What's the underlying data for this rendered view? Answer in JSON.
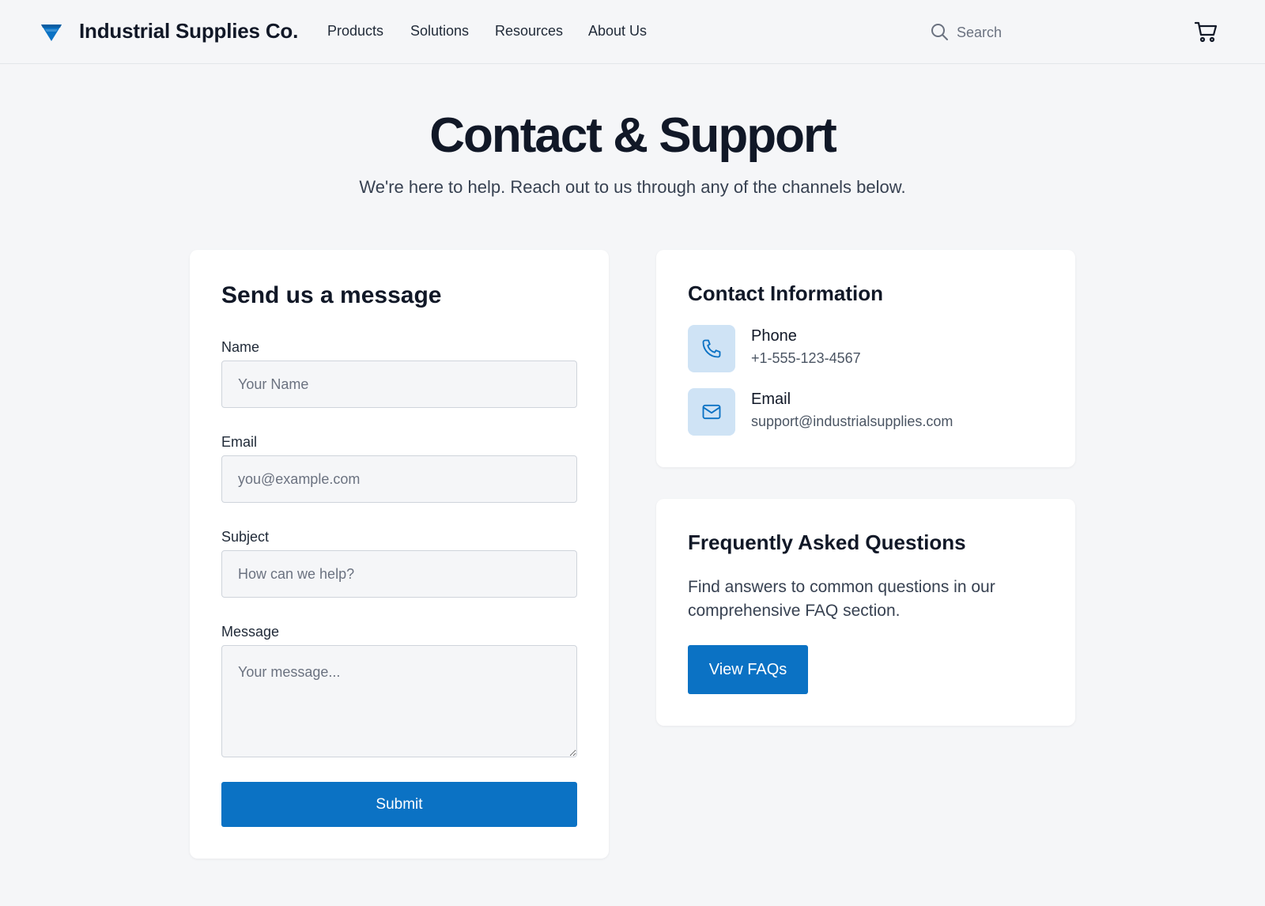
{
  "header": {
    "brand": "Industrial Supplies Co.",
    "nav": [
      "Products",
      "Solutions",
      "Resources",
      "About Us"
    ],
    "search_placeholder": "Search",
    "icons": {
      "logo": "funnel-logo-icon",
      "search": "search-icon",
      "cart": "cart-icon"
    }
  },
  "hero": {
    "title": "Contact & Support",
    "subtitle": "We're here to help. Reach out to us through any of the channels below."
  },
  "form": {
    "title": "Send us a message",
    "fields": [
      {
        "label": "Name",
        "placeholder": "Your Name",
        "value": ""
      },
      {
        "label": "Email",
        "placeholder": "you@example.com",
        "value": ""
      },
      {
        "label": "Subject",
        "placeholder": "How can we help?",
        "value": ""
      },
      {
        "label": "Message",
        "placeholder": "Your message...",
        "value": ""
      }
    ],
    "submit_label": "Submit"
  },
  "contact": {
    "title": "Contact Information",
    "items": [
      {
        "icon": "phone-icon",
        "label": "Phone",
        "value": "+1-555-123-4567"
      },
      {
        "icon": "envelope-icon",
        "label": "Email",
        "value": "support@industrialsupplies.com"
      }
    ]
  },
  "faq": {
    "title": "Frequently Asked Questions",
    "text": "Find answers to common questions in our comprehensive FAQ section.",
    "button_label": "View FAQs"
  },
  "colors": {
    "accent": "#0b72c4",
    "background": "#f5f6f8",
    "icon_box": "#cfe3f5",
    "text_primary": "#111827"
  }
}
